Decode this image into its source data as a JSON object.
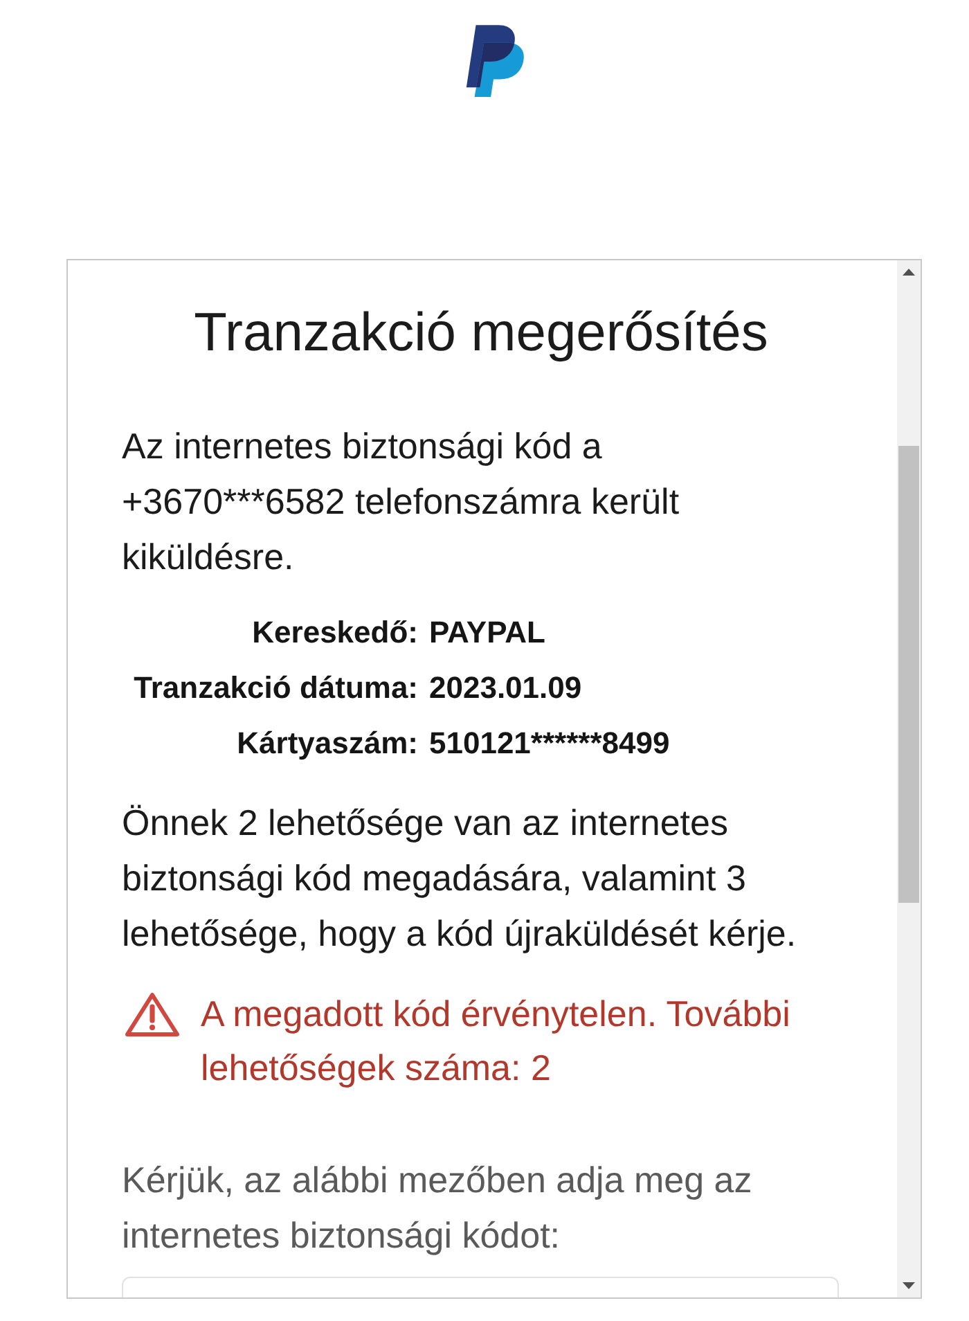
{
  "dialog": {
    "title": "Tranzakció megerősítés",
    "intro": "Az internetes biztonsági kód a +3670***6582 telefonszámra került kiküldésre.",
    "details": [
      {
        "label": "Kereskedő:",
        "value": "PAYPAL"
      },
      {
        "label": "Tranzakció dátuma:",
        "value": "2023.01.09"
      },
      {
        "label": "Kártyaszám:",
        "value": "510121******8499"
      }
    ],
    "attempts_note": "Önnek 2 lehetősége van az internetes biztonsági kód megadására, valamint 3 lehetősége, hogy a kód újraküldését kérje.",
    "error": {
      "message": "A megadott kód érvénytelen. További lehetőségek száma: 2"
    },
    "instruction": "Kérjük, az alábbi mezőben adja meg az internetes biztonsági kódot:"
  }
}
